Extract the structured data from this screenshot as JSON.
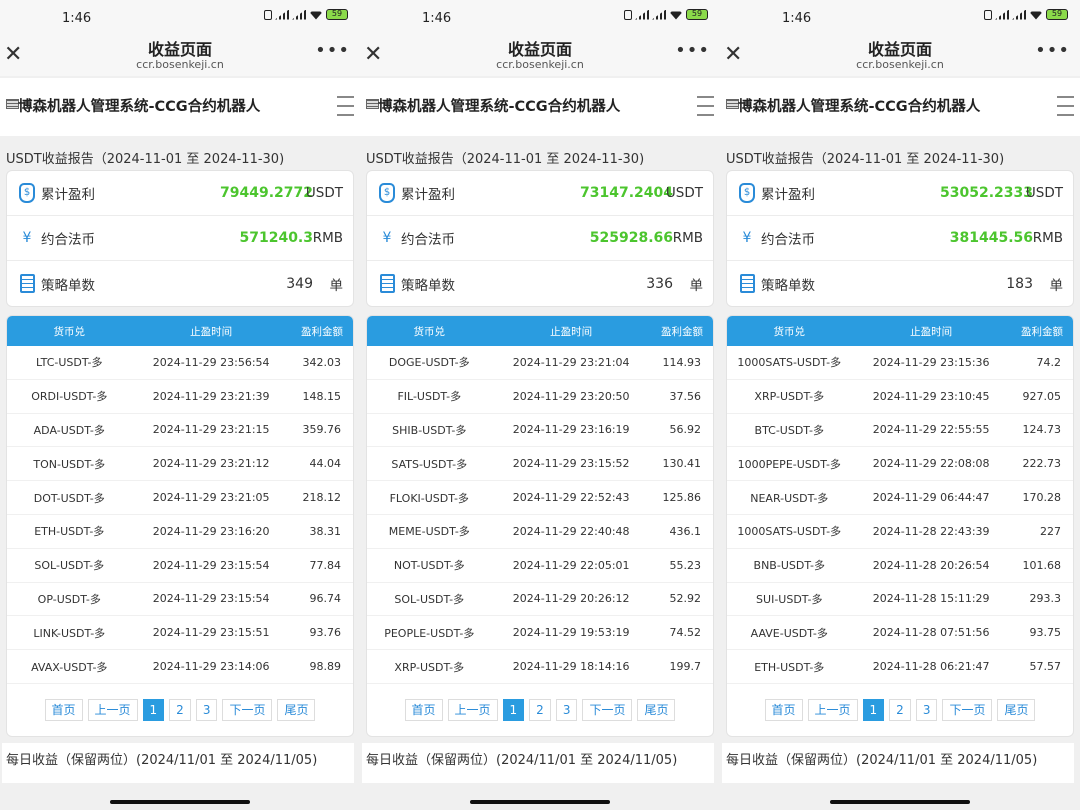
{
  "status": {
    "time": "1:46",
    "battery": "59"
  },
  "browser": {
    "title": "收益页面",
    "url": "ccr.bosenkeji.cn"
  },
  "app": {
    "name": "博森机器人管理系统-CCG合约机器人"
  },
  "labels": {
    "report": "USDT收益报告（2024-11-01 至 2024-11-30)",
    "profit": "累计盈利",
    "fiat": "约合法币",
    "orders": "策略单数",
    "usdt": "USDT",
    "rmb": "RMB",
    "dan": "单",
    "col_coin": "货币兑",
    "col_time": "止盈时间",
    "col_amount": "盈利金额",
    "first": "首页",
    "prev": "上一页",
    "next": "下一页",
    "last": "尾页",
    "p1": "1",
    "p2": "2",
    "p3": "3",
    "daily": "每日收益（保留两位）(2024/11/01 至 2024/11/05)"
  },
  "screens": [
    {
      "profit": "79449.2772",
      "fiat": "571240.3",
      "orders": "349",
      "rows": [
        [
          "LTC-USDT-多",
          "2024-11-29 23:56:54",
          "342.03"
        ],
        [
          "ORDI-USDT-多",
          "2024-11-29 23:21:39",
          "148.15"
        ],
        [
          "ADA-USDT-多",
          "2024-11-29 23:21:15",
          "359.76"
        ],
        [
          "TON-USDT-多",
          "2024-11-29 23:21:12",
          "44.04"
        ],
        [
          "DOT-USDT-多",
          "2024-11-29 23:21:05",
          "218.12"
        ],
        [
          "ETH-USDT-多",
          "2024-11-29 23:16:20",
          "38.31"
        ],
        [
          "SOL-USDT-多",
          "2024-11-29 23:15:54",
          "77.84"
        ],
        [
          "OP-USDT-多",
          "2024-11-29 23:15:54",
          "96.74"
        ],
        [
          "LINK-USDT-多",
          "2024-11-29 23:15:51",
          "93.76"
        ],
        [
          "AVAX-USDT-多",
          "2024-11-29 23:14:06",
          "98.89"
        ]
      ]
    },
    {
      "profit": "73147.2404",
      "fiat": "525928.66",
      "orders": "336",
      "rows": [
        [
          "DOGE-USDT-多",
          "2024-11-29 23:21:04",
          "114.93"
        ],
        [
          "FIL-USDT-多",
          "2024-11-29 23:20:50",
          "37.56"
        ],
        [
          "SHIB-USDT-多",
          "2024-11-29 23:16:19",
          "56.92"
        ],
        [
          "SATS-USDT-多",
          "2024-11-29 23:15:52",
          "130.41"
        ],
        [
          "FLOKI-USDT-多",
          "2024-11-29 22:52:43",
          "125.86"
        ],
        [
          "MEME-USDT-多",
          "2024-11-29 22:40:48",
          "436.1"
        ],
        [
          "NOT-USDT-多",
          "2024-11-29 22:05:01",
          "55.23"
        ],
        [
          "SOL-USDT-多",
          "2024-11-29 20:26:12",
          "52.92"
        ],
        [
          "PEOPLE-USDT-多",
          "2024-11-29 19:53:19",
          "74.52"
        ],
        [
          "XRP-USDT-多",
          "2024-11-29 18:14:16",
          "199.7"
        ]
      ]
    },
    {
      "profit": "53052.2333",
      "fiat": "381445.56",
      "orders": "183",
      "rows": [
        [
          "1000SATS-USDT-多",
          "2024-11-29 23:15:36",
          "74.2"
        ],
        [
          "XRP-USDT-多",
          "2024-11-29 23:10:45",
          "927.05"
        ],
        [
          "BTC-USDT-多",
          "2024-11-29 22:55:55",
          "124.73"
        ],
        [
          "1000PEPE-USDT-多",
          "2024-11-29 22:08:08",
          "222.73"
        ],
        [
          "NEAR-USDT-多",
          "2024-11-29 06:44:47",
          "170.28"
        ],
        [
          "1000SATS-USDT-多",
          "2024-11-28 22:43:39",
          "227"
        ],
        [
          "BNB-USDT-多",
          "2024-11-28 20:26:54",
          "101.68"
        ],
        [
          "SUI-USDT-多",
          "2024-11-28 15:11:29",
          "293.3"
        ],
        [
          "AAVE-USDT-多",
          "2024-11-28 07:51:56",
          "93.75"
        ],
        [
          "ETH-USDT-多",
          "2024-11-28 06:21:47",
          "57.57"
        ]
      ]
    }
  ]
}
